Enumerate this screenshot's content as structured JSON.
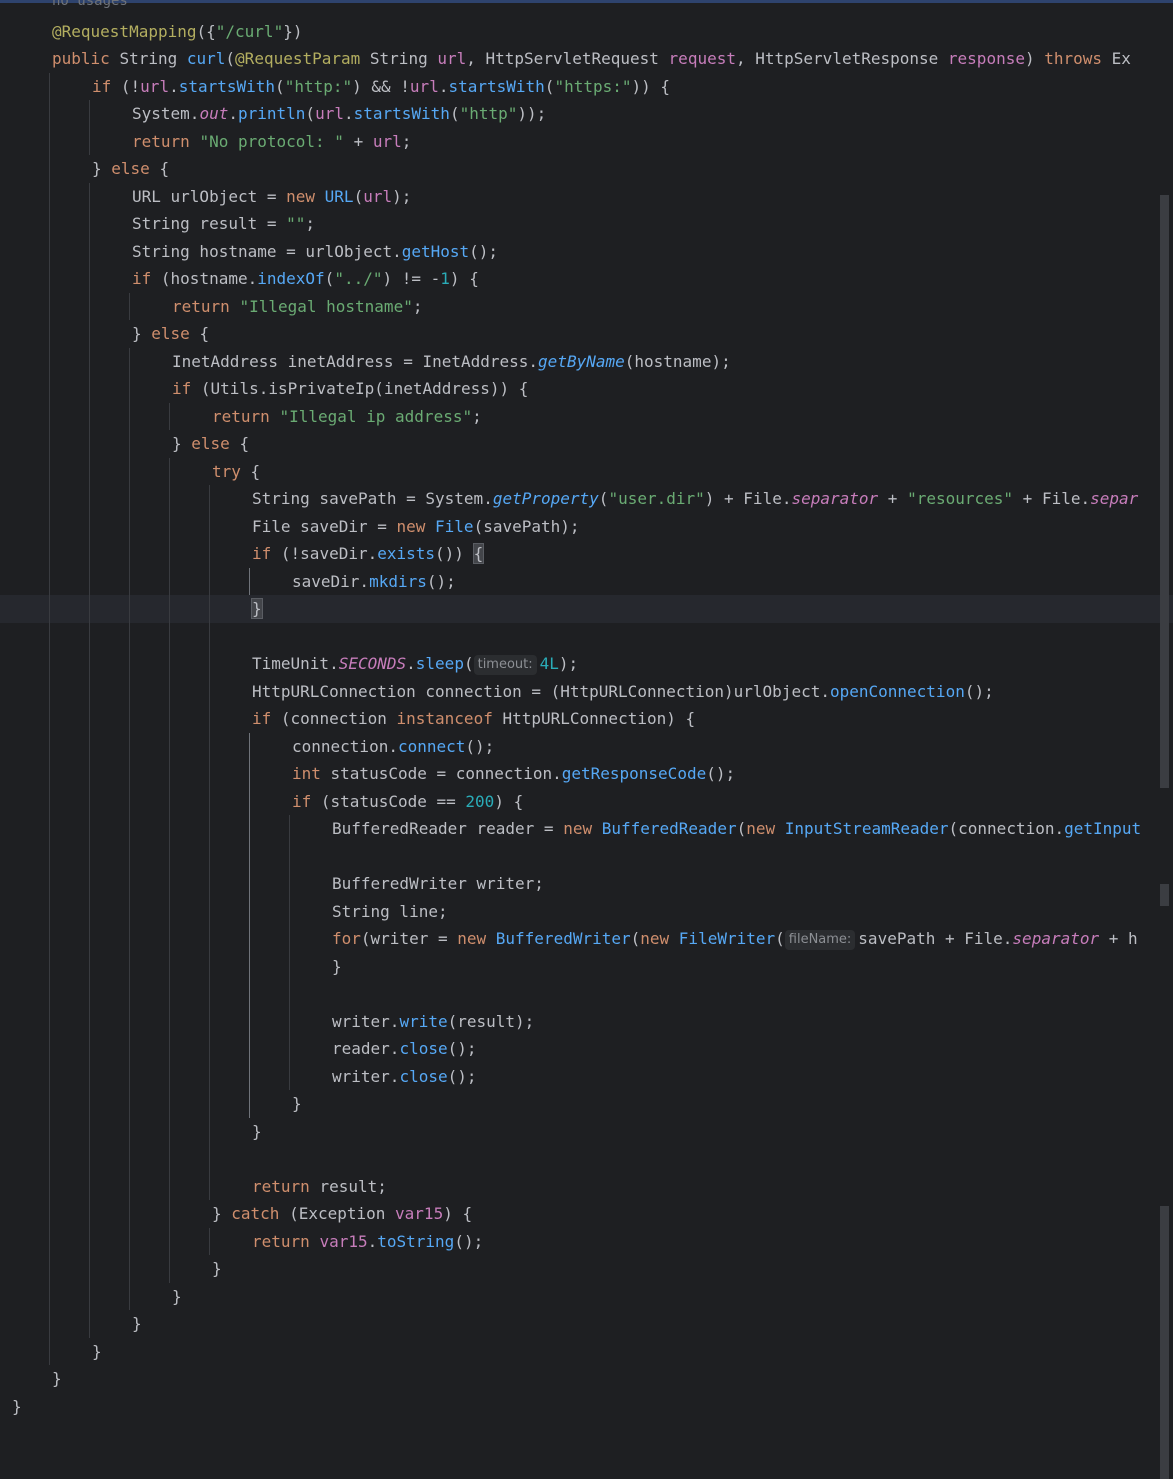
{
  "editor": {
    "inlay_usages": "no usages",
    "lines": [
      {
        "indent": 1,
        "tokens": [
          {
            "t": "@RequestMapping",
            "c": "ann"
          },
          {
            "t": "({"
          },
          {
            "t": "\"/curl\"",
            "c": "str"
          },
          {
            "t": "})"
          }
        ]
      },
      {
        "indent": 1,
        "tokens": [
          {
            "t": "public ",
            "c": "kw"
          },
          {
            "t": "String "
          },
          {
            "t": "curl",
            "c": "fn"
          },
          {
            "t": "("
          },
          {
            "t": "@RequestParam ",
            "c": "ann"
          },
          {
            "t": "String "
          },
          {
            "t": "url",
            "c": "sfield_plain"
          },
          {
            "t": ", HttpServletRequest "
          },
          {
            "t": "request",
            "c": "sfield_plain"
          },
          {
            "t": ", HttpServletResponse "
          },
          {
            "t": "response",
            "c": "sfield_plain"
          },
          {
            "t": ") "
          },
          {
            "t": "throws ",
            "c": "kw"
          },
          {
            "t": "Ex"
          }
        ]
      },
      {
        "indent": 2,
        "tokens": [
          {
            "t": "if ",
            "c": "kw"
          },
          {
            "t": "(!"
          },
          {
            "t": "url",
            "c": "sfield_plain"
          },
          {
            "t": "."
          },
          {
            "t": "startsWith",
            "c": "mcall"
          },
          {
            "t": "("
          },
          {
            "t": "\"http:\"",
            "c": "str"
          },
          {
            "t": ") && !"
          },
          {
            "t": "url",
            "c": "sfield_plain"
          },
          {
            "t": "."
          },
          {
            "t": "startsWith",
            "c": "mcall"
          },
          {
            "t": "("
          },
          {
            "t": "\"https:\"",
            "c": "str"
          },
          {
            "t": ")) {"
          }
        ]
      },
      {
        "indent": 3,
        "tokens": [
          {
            "t": "System."
          },
          {
            "t": "out",
            "c": "sfield"
          },
          {
            "t": "."
          },
          {
            "t": "println",
            "c": "mcall"
          },
          {
            "t": "("
          },
          {
            "t": "url",
            "c": "sfield_plain"
          },
          {
            "t": "."
          },
          {
            "t": "startsWith",
            "c": "mcall"
          },
          {
            "t": "("
          },
          {
            "t": "\"http\"",
            "c": "str"
          },
          {
            "t": "));"
          }
        ]
      },
      {
        "indent": 3,
        "tokens": [
          {
            "t": "return ",
            "c": "kw"
          },
          {
            "t": "\"No protocol: \"",
            "c": "str"
          },
          {
            "t": " + "
          },
          {
            "t": "url",
            "c": "sfield_plain"
          },
          {
            "t": ";"
          }
        ]
      },
      {
        "indent": 2,
        "tokens": [
          {
            "t": "} "
          },
          {
            "t": "else ",
            "c": "kw"
          },
          {
            "t": "{"
          }
        ]
      },
      {
        "indent": 3,
        "tokens": [
          {
            "t": "URL urlObject = "
          },
          {
            "t": "new ",
            "c": "kw"
          },
          {
            "t": "URL",
            "c": "mcall"
          },
          {
            "t": "("
          },
          {
            "t": "url",
            "c": "sfield_plain"
          },
          {
            "t": ");"
          }
        ]
      },
      {
        "indent": 3,
        "tokens": [
          {
            "t": "String result = "
          },
          {
            "t": "\"\"",
            "c": "str"
          },
          {
            "t": ";"
          }
        ]
      },
      {
        "indent": 3,
        "tokens": [
          {
            "t": "String hostname = urlObject."
          },
          {
            "t": "getHost",
            "c": "mcall"
          },
          {
            "t": "();"
          }
        ]
      },
      {
        "indent": 3,
        "tokens": [
          {
            "t": "if ",
            "c": "kw"
          },
          {
            "t": "(hostname."
          },
          {
            "t": "indexOf",
            "c": "mcall"
          },
          {
            "t": "("
          },
          {
            "t": "\"../\"",
            "c": "str"
          },
          {
            "t": ") != -"
          },
          {
            "t": "1",
            "c": "num"
          },
          {
            "t": ") {"
          }
        ]
      },
      {
        "indent": 4,
        "tokens": [
          {
            "t": "return ",
            "c": "kw"
          },
          {
            "t": "\"Illegal hostname\"",
            "c": "str"
          },
          {
            "t": ";"
          }
        ]
      },
      {
        "indent": 3,
        "tokens": [
          {
            "t": "} "
          },
          {
            "t": "else ",
            "c": "kw"
          },
          {
            "t": "{"
          }
        ]
      },
      {
        "indent": 4,
        "tokens": [
          {
            "t": "InetAddress inetAddress = InetAddress."
          },
          {
            "t": "getByName",
            "c": "smethod"
          },
          {
            "t": "(hostname);"
          }
        ]
      },
      {
        "indent": 4,
        "tokens": [
          {
            "t": "if ",
            "c": "kw"
          },
          {
            "t": "(Utils.isPrivateIp(inetAddress)) {"
          }
        ]
      },
      {
        "indent": 5,
        "tokens": [
          {
            "t": "return ",
            "c": "kw"
          },
          {
            "t": "\"Illegal ip address\"",
            "c": "str"
          },
          {
            "t": ";"
          }
        ]
      },
      {
        "indent": 4,
        "tokens": [
          {
            "t": "} "
          },
          {
            "t": "else ",
            "c": "kw"
          },
          {
            "t": "{"
          }
        ]
      },
      {
        "indent": 5,
        "tokens": [
          {
            "t": "try ",
            "c": "kw"
          },
          {
            "t": "{"
          }
        ]
      },
      {
        "indent": 6,
        "tokens": [
          {
            "t": "String savePath = System."
          },
          {
            "t": "getProperty",
            "c": "smethod"
          },
          {
            "t": "("
          },
          {
            "t": "\"user.dir\"",
            "c": "str"
          },
          {
            "t": ") + File."
          },
          {
            "t": "separator",
            "c": "sfield"
          },
          {
            "t": " + "
          },
          {
            "t": "\"resources\"",
            "c": "str"
          },
          {
            "t": " + File."
          },
          {
            "t": "separ",
            "c": "sfield"
          }
        ]
      },
      {
        "indent": 6,
        "tokens": [
          {
            "t": "File saveDir = "
          },
          {
            "t": "new ",
            "c": "kw"
          },
          {
            "t": "File",
            "c": "mcall"
          },
          {
            "t": "(savePath);"
          }
        ]
      },
      {
        "indent": 6,
        "tokens": [
          {
            "t": "if ",
            "c": "kw"
          },
          {
            "t": "(!saveDir."
          },
          {
            "t": "exists",
            "c": "mcall"
          },
          {
            "t": "()) "
          },
          {
            "t": "{",
            "c": "brace"
          }
        ]
      },
      {
        "indent": 7,
        "tokens": [
          {
            "t": "saveDir."
          },
          {
            "t": "mkdirs",
            "c": "mcall"
          },
          {
            "t": "();"
          }
        ]
      },
      {
        "indent": 6,
        "current": true,
        "tokens": [
          {
            "t": "}",
            "c": "brace"
          }
        ]
      },
      {
        "indent": 6,
        "tokens": []
      },
      {
        "indent": 6,
        "tokens": [
          {
            "t": "TimeUnit."
          },
          {
            "t": "SECONDS",
            "c": "sfield"
          },
          {
            "t": "."
          },
          {
            "t": "sleep",
            "c": "mcall"
          },
          {
            "t": "("
          },
          {
            "hint": "timeout:"
          },
          {
            "t": "4L",
            "c": "num"
          },
          {
            "t": ");"
          }
        ]
      },
      {
        "indent": 6,
        "tokens": [
          {
            "t": "HttpURLConnection connection = (HttpURLConnection)urlObject."
          },
          {
            "t": "openConnection",
            "c": "mcall"
          },
          {
            "t": "();"
          }
        ]
      },
      {
        "indent": 6,
        "tokens": [
          {
            "t": "if ",
            "c": "kw"
          },
          {
            "t": "(connection "
          },
          {
            "t": "instanceof ",
            "c": "kw"
          },
          {
            "t": "HttpURLConnection) {"
          }
        ]
      },
      {
        "indent": 7,
        "tokens": [
          {
            "t": "connection."
          },
          {
            "t": "connect",
            "c": "mcall"
          },
          {
            "t": "();"
          }
        ]
      },
      {
        "indent": 7,
        "tokens": [
          {
            "t": "int ",
            "c": "kw"
          },
          {
            "t": "statusCode = connection."
          },
          {
            "t": "getResponseCode",
            "c": "mcall"
          },
          {
            "t": "();"
          }
        ]
      },
      {
        "indent": 7,
        "tokens": [
          {
            "t": "if ",
            "c": "kw"
          },
          {
            "t": "(statusCode == "
          },
          {
            "t": "200",
            "c": "num"
          },
          {
            "t": ") {"
          }
        ]
      },
      {
        "indent": 8,
        "tokens": [
          {
            "t": "BufferedReader reader = "
          },
          {
            "t": "new ",
            "c": "kw"
          },
          {
            "t": "BufferedReader",
            "c": "mcall"
          },
          {
            "t": "("
          },
          {
            "t": "new ",
            "c": "kw"
          },
          {
            "t": "InputStreamReader",
            "c": "mcall"
          },
          {
            "t": "(connection."
          },
          {
            "t": "getInput",
            "c": "mcall"
          }
        ]
      },
      {
        "indent": 8,
        "tokens": []
      },
      {
        "indent": 8,
        "tokens": [
          {
            "t": "BufferedWriter writer;"
          }
        ]
      },
      {
        "indent": 8,
        "tokens": [
          {
            "t": "String line;"
          }
        ]
      },
      {
        "indent": 8,
        "tokens": [
          {
            "t": "for",
            "c": "kw"
          },
          {
            "t": "(writer = "
          },
          {
            "t": "new ",
            "c": "kw"
          },
          {
            "t": "BufferedWriter",
            "c": "mcall"
          },
          {
            "t": "("
          },
          {
            "t": "new ",
            "c": "kw"
          },
          {
            "t": "FileWriter",
            "c": "mcall"
          },
          {
            "t": "("
          },
          {
            "hint": "fileName:"
          },
          {
            "t": "savePath + File."
          },
          {
            "t": "separator",
            "c": "sfield"
          },
          {
            "t": " + h"
          }
        ]
      },
      {
        "indent": 8,
        "tokens": [
          {
            "t": "}"
          }
        ]
      },
      {
        "indent": 8,
        "tokens": []
      },
      {
        "indent": 8,
        "tokens": [
          {
            "t": "writer."
          },
          {
            "t": "write",
            "c": "mcall"
          },
          {
            "t": "(result);"
          }
        ]
      },
      {
        "indent": 8,
        "tokens": [
          {
            "t": "reader."
          },
          {
            "t": "close",
            "c": "mcall"
          },
          {
            "t": "();"
          }
        ]
      },
      {
        "indent": 8,
        "tokens": [
          {
            "t": "writer."
          },
          {
            "t": "close",
            "c": "mcall"
          },
          {
            "t": "();"
          }
        ]
      },
      {
        "indent": 7,
        "tokens": [
          {
            "t": "}"
          }
        ]
      },
      {
        "indent": 6,
        "tokens": [
          {
            "t": "}"
          }
        ]
      },
      {
        "indent": 6,
        "tokens": []
      },
      {
        "indent": 6,
        "tokens": [
          {
            "t": "return ",
            "c": "kw"
          },
          {
            "t": "result;"
          }
        ]
      },
      {
        "indent": 5,
        "tokens": [
          {
            "t": "} "
          },
          {
            "t": "catch ",
            "c": "kw"
          },
          {
            "t": "(Exception "
          },
          {
            "t": "var15",
            "c": "sfield_plain"
          },
          {
            "t": ") {"
          }
        ]
      },
      {
        "indent": 6,
        "tokens": [
          {
            "t": "return ",
            "c": "kw"
          },
          {
            "t": "var15",
            "c": "sfield_plain"
          },
          {
            "t": "."
          },
          {
            "t": "toString",
            "c": "mcall"
          },
          {
            "t": "();"
          }
        ]
      },
      {
        "indent": 5,
        "tokens": [
          {
            "t": "}"
          }
        ]
      },
      {
        "indent": 4,
        "tokens": [
          {
            "t": "}"
          }
        ]
      },
      {
        "indent": 3,
        "tokens": [
          {
            "t": "}"
          }
        ]
      },
      {
        "indent": 2,
        "tokens": [
          {
            "t": "}"
          }
        ]
      },
      {
        "indent": 1,
        "tokens": [
          {
            "t": "}"
          }
        ]
      },
      {
        "indent": 0,
        "tokens": [
          {
            "t": "}"
          }
        ]
      }
    ]
  }
}
